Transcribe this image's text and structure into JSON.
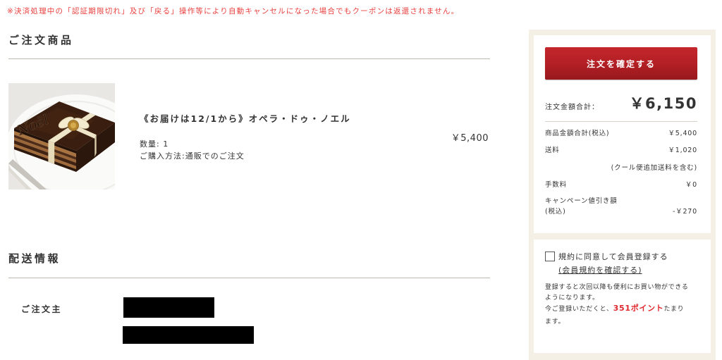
{
  "notice": "※決済処理中の「認証期限切れ」及び「戻る」操作等により自動キャンセルになった場合でもクーポンは返還されません。",
  "order_items": {
    "heading": "ご注文商品",
    "items": [
      {
        "image": "opera-cake-photo",
        "image_lettering": "Noël",
        "title": "《お届けは12/1から》オペラ・ドゥ・ノエル",
        "quantity": "数量: 1",
        "purchase_method": "ご購入方法:通販でのご注文",
        "price": "￥5,400"
      }
    ]
  },
  "delivery": {
    "heading": "配送情報",
    "orderer_label": "ご注文主"
  },
  "summary": {
    "confirm_button": "注文を確定する",
    "total_label": "注文金額合計：",
    "total_value": "￥6,150",
    "rows": [
      {
        "label": "商品金額合計(税込)",
        "value": "￥5,400"
      },
      {
        "label": "送料",
        "value": "￥1,020",
        "note": "(クール便追加送料を含む)"
      },
      {
        "label": "手数料",
        "value": "￥0"
      },
      {
        "label": "キャンペーン値引き額",
        "label_sub": "(税込)",
        "value": "-￥270"
      }
    ]
  },
  "registration": {
    "checkbox_checked": false,
    "checkbox_label": "規約に同意して会員登録する",
    "terms_link": "(会員規約を確認する)",
    "description": "登録すると次回以降も便利にお買い物ができるようになります。",
    "points_prefix": "今ご登録いただくと、",
    "points_value": "351ポイント",
    "points_suffix": "たまります。"
  },
  "colors": {
    "notice": "#e8413f",
    "button": "#b11f24",
    "points": "#e0282e",
    "panel_background": "#f4f0e6"
  }
}
